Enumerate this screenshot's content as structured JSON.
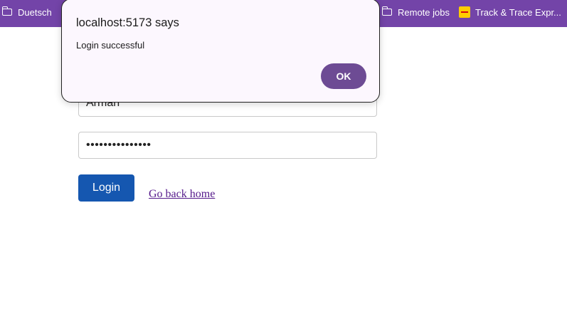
{
  "bookmarks_bar": {
    "items": [
      {
        "label": "Duetsch",
        "icon": "folder-icon"
      },
      {
        "label": "Remote jobs",
        "icon": "folder-icon"
      },
      {
        "label": "Track & Trace Expr...",
        "icon": "dhl-icon"
      }
    ]
  },
  "form": {
    "username_value": "Arman",
    "password_value": "•••••••••••••••",
    "login_label": "Login",
    "home_link_label": "Go back home"
  },
  "alert": {
    "title": "localhost:5173 says",
    "message": "Login successful",
    "ok_label": "OK"
  },
  "colors": {
    "bookmarks_bar": "#7344a8",
    "login_button": "#1557b0",
    "ok_button": "#6d4b94",
    "link": "#551a8b"
  }
}
